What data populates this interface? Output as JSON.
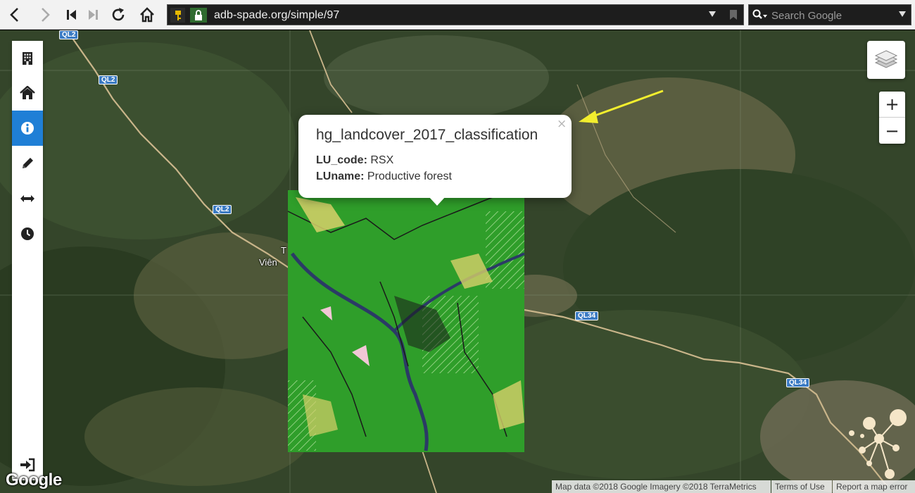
{
  "browser": {
    "url": "adb-spade.org/simple/97",
    "search_placeholder": "Search Google"
  },
  "sidebar": {
    "items": [
      {
        "icon": "building-icon"
      },
      {
        "icon": "home-icon"
      },
      {
        "icon": "info-icon",
        "active": true
      },
      {
        "icon": "pencil-icon"
      },
      {
        "icon": "measure-arrows-icon"
      },
      {
        "icon": "clock-icon"
      },
      {
        "icon": "sign-in-icon"
      }
    ]
  },
  "map": {
    "zoom_in_label": "+",
    "zoom_out_label": "−",
    "road_labels": [
      "QL2",
      "QL2",
      "QL2",
      "QL34",
      "QL34"
    ],
    "place_label": "Viên",
    "place_label_fragment": "T"
  },
  "popup": {
    "title": "hg_landcover_2017_classification",
    "close_label": "×",
    "fields": [
      {
        "key": "LU_code:",
        "value": "RSX"
      },
      {
        "key": "LUname:",
        "value": "Productive forest"
      }
    ]
  },
  "attribution": {
    "google": "Google",
    "map_data": "Map data ©2018 Google Imagery ©2018 TerraMetrics",
    "terms": "Terms of Use",
    "report": "Report a map error"
  },
  "colors": {
    "active_blue": "#1f7fd6",
    "landcover_green": "#2f9e2a",
    "annotation_arrow": "#f2ee2e"
  }
}
